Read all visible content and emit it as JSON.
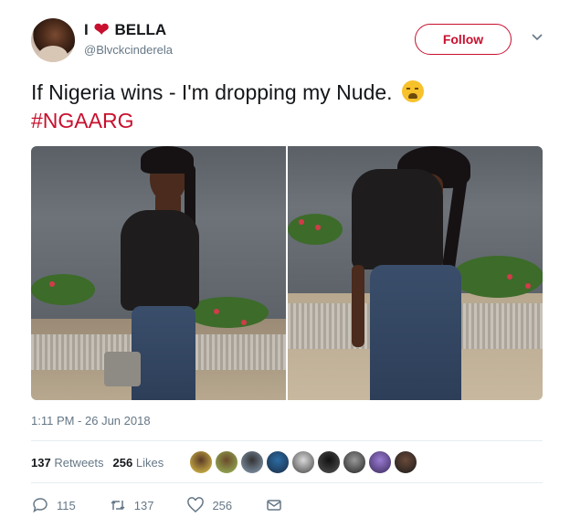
{
  "user": {
    "display_name_prefix": "I",
    "display_name_suffix": "BELLA",
    "handle": "@Blvckcinderela"
  },
  "follow_label": "Follow",
  "tweet": {
    "text": "If Nigeria wins - I'm dropping my Nude.",
    "hashtag": "#NGAARG"
  },
  "timestamp": "1:11 PM - 26 Jun 2018",
  "stats": {
    "retweets_count": "137",
    "retweets_label": "Retweets",
    "likes_count": "256",
    "likes_label": "Likes"
  },
  "actions": {
    "replies": "115",
    "retweets": "137",
    "likes": "256"
  },
  "colors": {
    "accent": "#c8102e",
    "muted": "#657786",
    "text": "#14171a"
  },
  "icons": [
    "heart-icon",
    "chevron-down-icon",
    "reply-icon",
    "retweet-icon",
    "like-icon",
    "message-icon"
  ]
}
